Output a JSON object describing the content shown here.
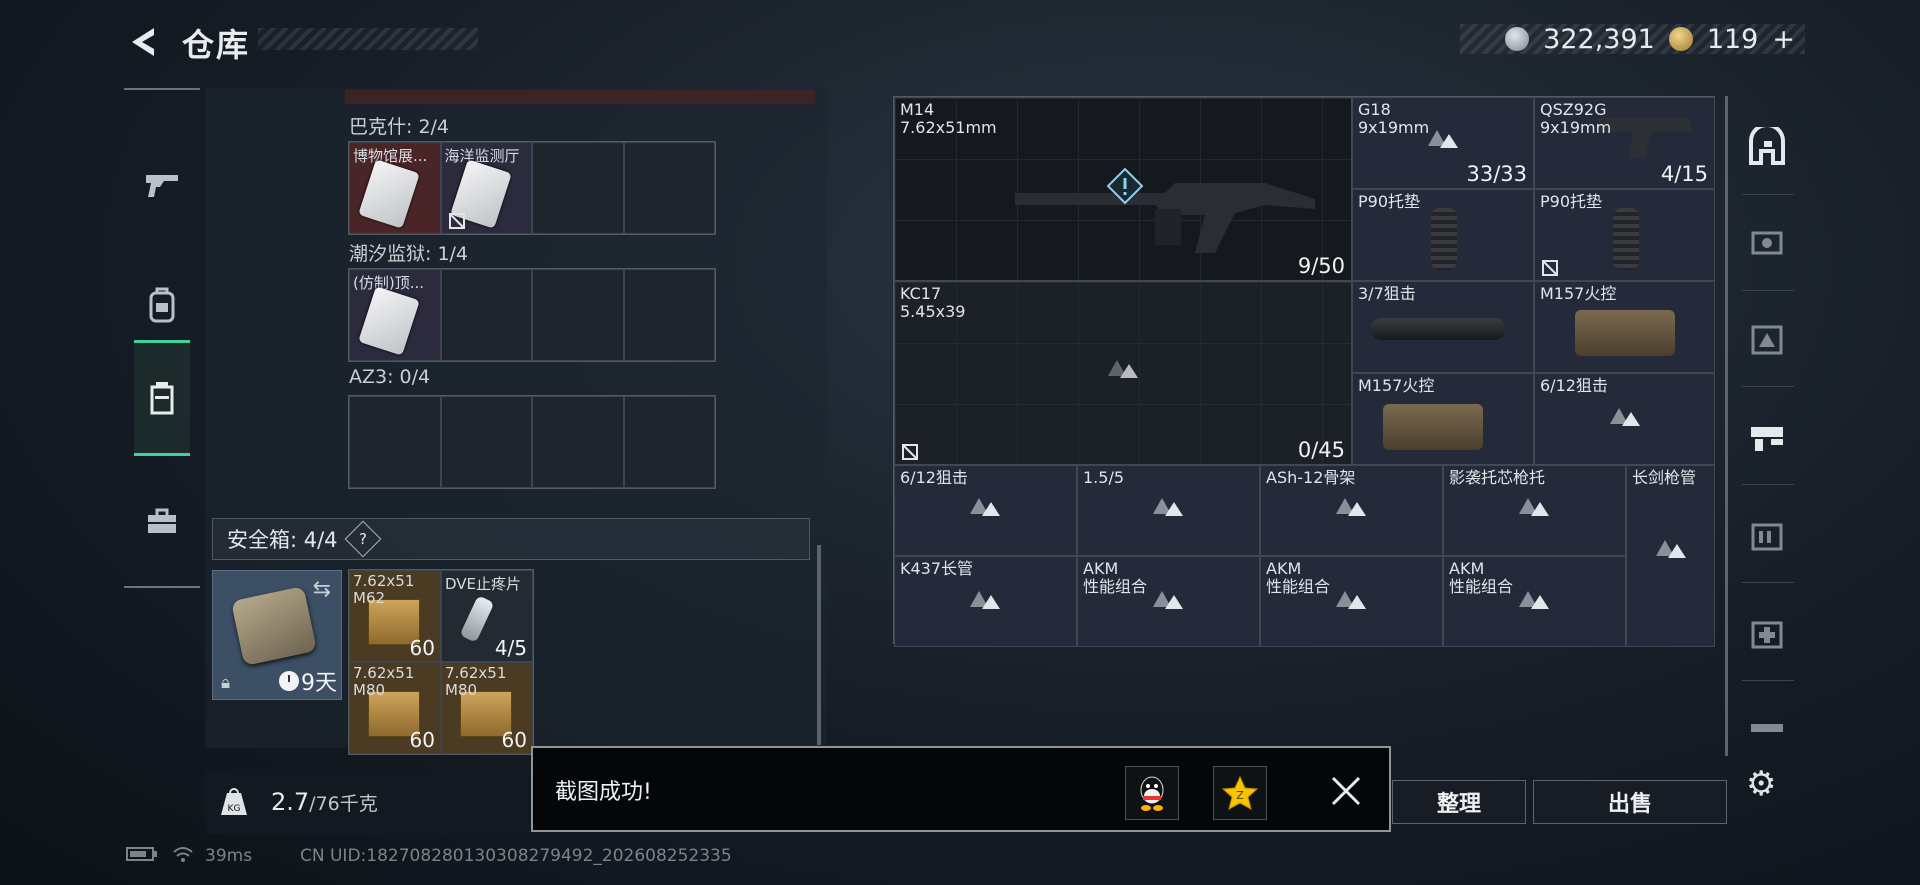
{
  "header": {
    "title": "仓库"
  },
  "currency": {
    "silver": "322,391",
    "gold": "119",
    "gold_plus": "+"
  },
  "left_nav": {
    "items": [
      "weapon-icon",
      "backpack-icon",
      "container-icon",
      "toolbox-icon"
    ],
    "active": "container-icon"
  },
  "sections": [
    {
      "label": "巴克什: 2/4",
      "slots": [
        {
          "name": "博物馆展...",
          "color": "red"
        },
        {
          "name": "海洋监测厅",
          "color": "purple",
          "nosell": true
        }
      ]
    },
    {
      "label": "潮汐监狱: 1/4",
      "slots": [
        {
          "name": "(仿制)顶...",
          "color": "purple"
        }
      ]
    },
    {
      "label": "AZ3: 0/4",
      "slots": []
    }
  ],
  "safebox": {
    "label": "安全箱: 4/4",
    "help": "?",
    "case_days": "9天",
    "items": [
      {
        "name": "7.62x51\nM62",
        "count": "60"
      },
      {
        "name": "DVE止疼片",
        "count": "4/5"
      },
      {
        "name": "7.62x51\nM80",
        "count": "60"
      },
      {
        "name": "7.62x51\nM80",
        "count": "60"
      }
    ]
  },
  "weight": {
    "current": "2.7",
    "max": "/76千克"
  },
  "grid": {
    "m14": {
      "name": "M14\n7.62x51mm",
      "count": "9/50"
    },
    "g18": {
      "name": "G18\n9x19mm",
      "count": "33/33"
    },
    "qsz": {
      "name": "QSZ92G\n9x19mm",
      "count": "4/15"
    },
    "p90a": {
      "name": "P90托垫"
    },
    "p90b": {
      "name": "P90托垫"
    },
    "kc17": {
      "name": "KC17\n5.45x39",
      "count": "0/45"
    },
    "scope37": {
      "name": "3/7狙击"
    },
    "m157a": {
      "name": "M157火控"
    },
    "m157b": {
      "name": "M157火控"
    },
    "scope612a": {
      "name": "6/12狙击"
    },
    "row3": [
      "6/12狙击",
      "1.5/5",
      "ASh-12骨架",
      "影袭托芯枪托",
      "长剑枪管"
    ],
    "row4": [
      "K437长管",
      "AKM\n性能组合",
      "AKM\n性能组合",
      "AKM\n性能组合"
    ]
  },
  "buttons": {
    "sort": "整理",
    "sell": "出售"
  },
  "toast": {
    "text": "截图成功!"
  },
  "status": {
    "ping": "39ms",
    "uid": "CN UID:18270828013030827949​2_202608252335"
  },
  "colors": {
    "accent": "#3fd59a"
  }
}
